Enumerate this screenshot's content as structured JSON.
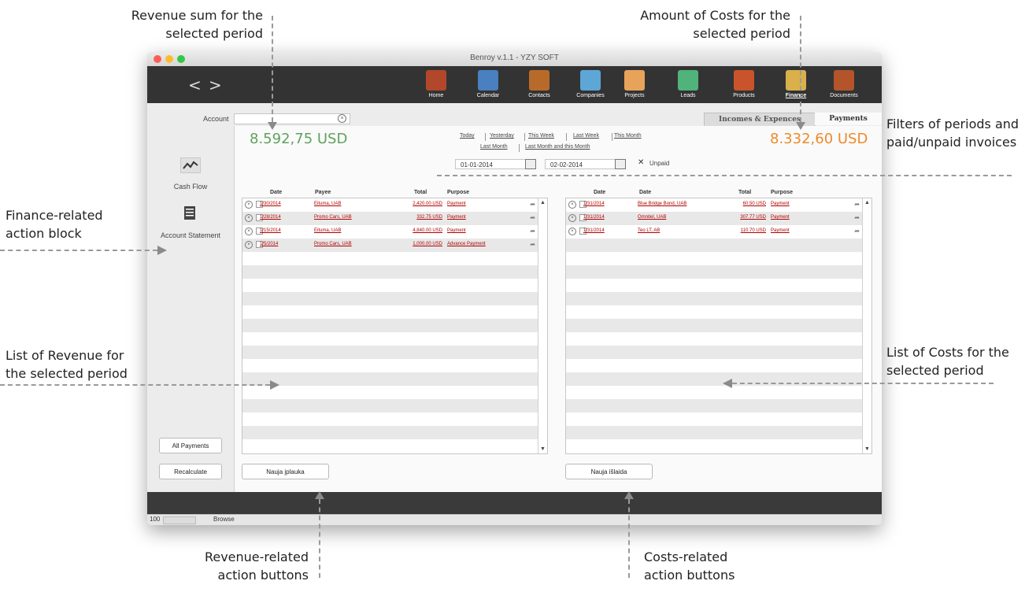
{
  "callouts": {
    "revenue_sum": "Revenue sum for the\nselected period",
    "costs_amount": "Amount of Costs for the\nselected period",
    "filters": "Filters of periods and\npaid/unpaid invoices",
    "finance_block": "Finance-related\naction block",
    "revenue_list": "List of Revenue for\nthe selected period",
    "costs_list": "List of Costs for the\nselected period",
    "revenue_buttons": "Revenue-related\naction buttons",
    "costs_buttons": "Costs-related\naction buttons"
  },
  "window": {
    "title": "Benroy v.1.1 - YZY SOFT"
  },
  "nav": {
    "back": "<",
    "forward": ">"
  },
  "toolbar": [
    {
      "label": "Home",
      "icon": "home-icon",
      "color": "#b3472b",
      "active": false
    },
    {
      "label": "Calendar",
      "icon": "calendar-icon",
      "color": "#4a7fc0",
      "active": false
    },
    {
      "label": "Contacts",
      "icon": "contacts-icon",
      "color": "#b86a2a",
      "active": false
    },
    {
      "label": "Companies",
      "icon": "companies-icon",
      "color": "#5ea6d6",
      "active": false
    },
    {
      "label": "Projects",
      "icon": "projects-icon",
      "color": "#e8a35a",
      "active": false
    },
    {
      "label": "Leads",
      "icon": "leads-icon",
      "color": "#4fb37b",
      "active": false
    },
    {
      "label": "Products",
      "icon": "products-icon",
      "color": "#c9542b",
      "active": false
    },
    {
      "label": "Finance",
      "icon": "finance-icon",
      "color": "#d9b04a",
      "active": true
    },
    {
      "label": "Documents",
      "icon": "documents-icon",
      "color": "#b3542b",
      "active": false
    }
  ],
  "account": {
    "label": "Account",
    "value": ""
  },
  "tabs": [
    "Incomes & Expences",
    "Payments"
  ],
  "sidebar": {
    "cash_flow": "Cash Flow",
    "account_statement": "Account Statement",
    "all_payments": "All Payments",
    "recalculate": "Recalculate"
  },
  "revenue_sum": "8.592,75 USD",
  "costs_sum": "8.332,60 USD",
  "colors": {
    "revenue": "#5fa25f",
    "costs": "#ee8a2a",
    "link": "#b00000"
  },
  "filters": {
    "links_row1": [
      "Today",
      "Yesterday",
      "This Week",
      "Last Week",
      "This Month"
    ],
    "links_row2": [
      "Last Month",
      "Last Month and this Month"
    ],
    "date_from": "01-01-2014",
    "date_to": "02-02-2014",
    "unpaid_label": "Unpaid",
    "unpaid_mark": "✕"
  },
  "revenue_table": {
    "headers": [
      "Date",
      "Payee",
      "Total",
      "Purpose"
    ],
    "rows": [
      {
        "date": "1/30/2014",
        "payee": "Eituma, UAB",
        "total": "2,420.00 USD",
        "purpose": "Payment"
      },
      {
        "date": "1/28/2014",
        "payee": "Promo Cars, UAB",
        "total": "332.75 USD",
        "purpose": "Payment"
      },
      {
        "date": "1/15/2014",
        "payee": "Eituma, UAB",
        "total": "4,840.00 USD",
        "purpose": "Payment"
      },
      {
        "date": "1/5/2014",
        "payee": "Promo Cars, UAB",
        "total": "1,000.00 USD",
        "purpose": "Advance Payment"
      }
    ]
  },
  "costs_table": {
    "headers": [
      "Date",
      "Date",
      "Total",
      "Purpose"
    ],
    "rows": [
      {
        "date": "1/31/2014",
        "payee": "Blue Bridge Bond, UAB",
        "total": "60.50 USD",
        "purpose": "Payment"
      },
      {
        "date": "1/31/2014",
        "payee": "Omnitel, UAB",
        "total": "307.77 USD",
        "purpose": "Payment"
      },
      {
        "date": "1/31/2014",
        "payee": "Teo LT, AB",
        "total": "110.70 USD",
        "purpose": "Payment"
      }
    ]
  },
  "buttons": {
    "new_revenue": "Nauja įplauka",
    "new_cost": "Nauja išlaida"
  },
  "bottombar": {
    "zoom": "100",
    "mode": "Browse"
  }
}
